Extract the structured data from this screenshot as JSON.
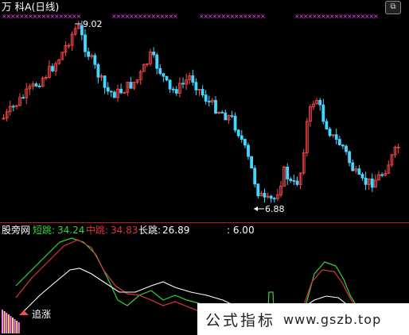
{
  "window": {
    "title": "万  科A(日线)",
    "corner_icon": "expand-icon"
  },
  "price_panel": {
    "high_label": "9.02",
    "low_label": "6.88"
  },
  "indicator_panel": {
    "name": "股旁网",
    "short_label": "短跳:",
    "short_value": "34.24",
    "mid_label": "中跳:",
    "mid_value": "34.83",
    "long_label": "长跳:",
    "long_value": "26.89",
    "extra_value": ": 6.00",
    "arrow_label": "追涨"
  },
  "watermark": {
    "cn": "公式指标",
    "url": "www.gszb.top"
  },
  "colors": {
    "up": "#ff4a4a",
    "down": "#45d6ff",
    "short": "#37d437",
    "mid": "#e03434",
    "long": "#ffffff",
    "marker": "#ff40ff",
    "divider": "#b02020"
  },
  "chart_data": [
    {
      "type": "candlestick",
      "title": "万 科A(日线)",
      "annotations": [
        {
          "text": "9.02",
          "note": "period high"
        },
        {
          "text": "6.88",
          "note": "period low"
        }
      ],
      "ylim": [
        6.6,
        9.2
      ]
    },
    {
      "type": "line",
      "series": [
        {
          "name": "短跳",
          "last": 34.24
        },
        {
          "name": "中跳",
          "last": 34.83
        },
        {
          "name": "长跳",
          "last": 26.89
        }
      ]
    }
  ]
}
